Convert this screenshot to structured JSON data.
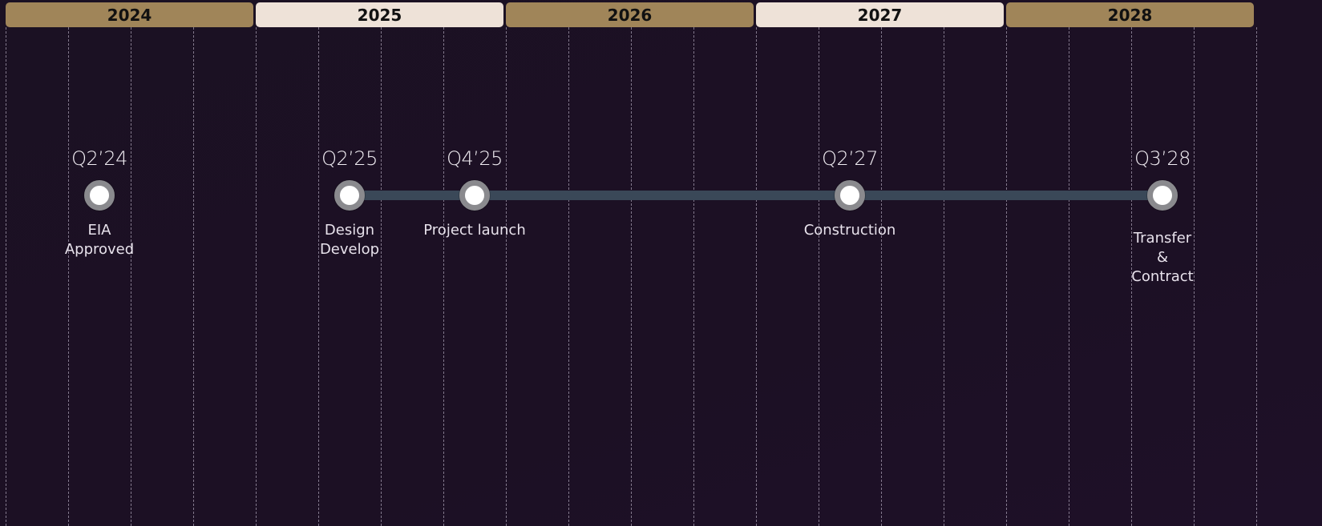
{
  "years": [
    {
      "label": "2024",
      "style": "gold"
    },
    {
      "label": "2025",
      "style": "cream"
    },
    {
      "label": "2026",
      "style": "gold"
    },
    {
      "label": "2027",
      "style": "cream"
    },
    {
      "label": "2028",
      "style": "gold"
    }
  ],
  "colors": {
    "background": "#1c1024",
    "gold": "#a08559",
    "cream": "#eee2d8",
    "connector": "#3a4858",
    "node_ring": "#8a8a8e",
    "node_fill": "#ffffff",
    "text": "#f2eef4"
  },
  "milestones": [
    {
      "quarter": "Q2’24",
      "label": "EIA\nApproved",
      "year": 2024,
      "q": 2
    },
    {
      "quarter": "Q2’25",
      "label": "Design\nDevelop",
      "year": 2025,
      "q": 2
    },
    {
      "quarter": "Q4’25",
      "label": "Project launch",
      "year": 2025,
      "q": 4
    },
    {
      "quarter": "Q2’27",
      "label": "Construction",
      "year": 2027,
      "q": 2
    },
    {
      "quarter": "Q3’28",
      "label": "Transfer\n&\nContract",
      "year": 2028,
      "q": 3
    }
  ],
  "connected_span": {
    "from_milestone": 1,
    "to_milestone": 4
  }
}
